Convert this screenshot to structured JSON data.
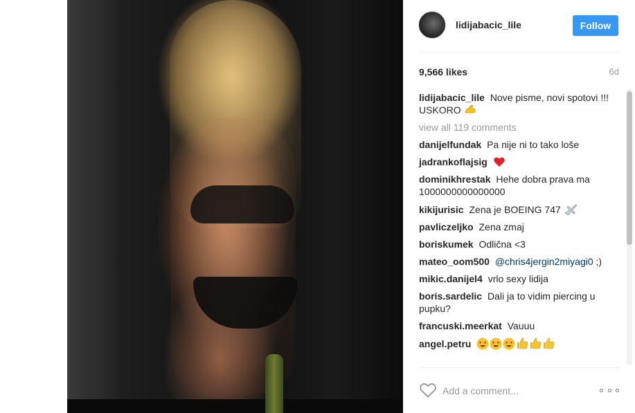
{
  "post": {
    "username": "lidijabacic_lile",
    "follow_label": "Follow",
    "likes": "9,566 likes",
    "time": "6d",
    "caption": {
      "user": "lidijabacic_lile",
      "text": "Nove pisme, novi spotovi !!! USKORO",
      "emoji": "flexed-biceps"
    },
    "view_all": "view all 119 comments",
    "comments": [
      {
        "user": "danijelfundak",
        "text": "Pa nije ni to tako loše"
      },
      {
        "user": "jadrankoflajsig",
        "text": "",
        "emoji": "red-heart"
      },
      {
        "user": "dominikhrestak",
        "text": "Hehe dobra prava ma 1000000000000000"
      },
      {
        "user": "kikijurisic",
        "text": "Zena je BOEING 747",
        "emoji": "airplane"
      },
      {
        "user": "pavliczeljko",
        "text": "Zena zmaj"
      },
      {
        "user": "boriskumek",
        "text": "Odlična <3"
      },
      {
        "user": "mateo_oom500",
        "mention": "@chris4jergin2miyagi0",
        "text": ";)"
      },
      {
        "user": "mikic.danijel4",
        "text": "vrlo sexy lidija"
      },
      {
        "user": "boris.sardelic",
        "text": "Dali ja to vidim piercing u pupku?"
      },
      {
        "user": "francuski.meerkat",
        "text": "Vauuu"
      },
      {
        "user": "angel.petru",
        "text": "",
        "emoji": "3x heart-eyes, 3x thumbs-up"
      }
    ],
    "comment_placeholder": "Add a comment...",
    "icons": {
      "like": "heart-outline-icon",
      "more": "more-options-icon"
    }
  },
  "colors": {
    "follow_button": "#3897f0",
    "mention": "#003569",
    "muted": "#999999"
  }
}
